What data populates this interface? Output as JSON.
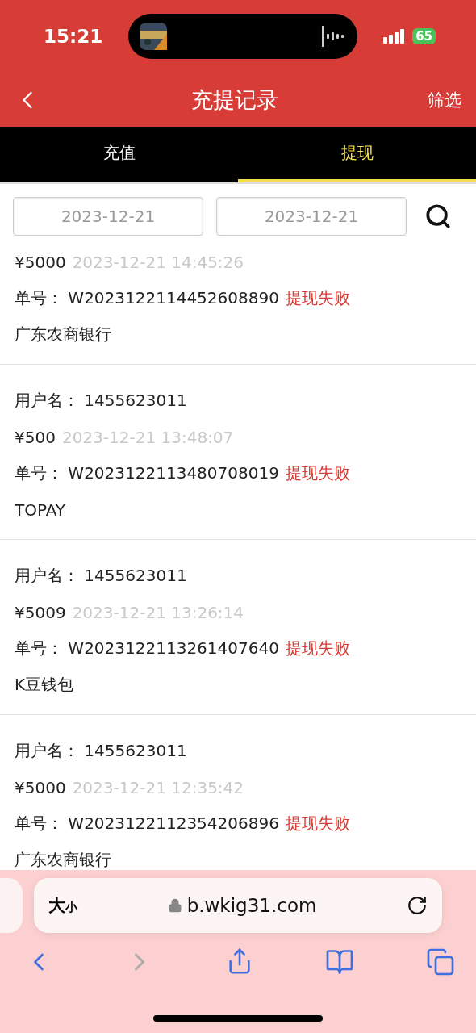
{
  "status_bar": {
    "time": "15:21",
    "battery": "65"
  },
  "header": {
    "title": "充提记录",
    "action": "筛选"
  },
  "tabs": [
    {
      "label": "充值",
      "selected": false
    },
    {
      "label": "提现",
      "selected": true
    }
  ],
  "filter": {
    "start_date": "2023-12-21",
    "end_date": "2023-12-21"
  },
  "records": [
    {
      "amount": "¥5000",
      "time": "2023-12-21 14:45:26",
      "order_label": "单号：",
      "order_no": "W2023122114452608890",
      "status": "提现失败",
      "method": "广东农商银行"
    },
    {
      "username_label": "用户名：",
      "username": "1455623011",
      "amount": "¥500",
      "time": "2023-12-21 13:48:07",
      "order_label": "单号：",
      "order_no": "W2023122113480708019",
      "status": "提现失败",
      "method": "TOPAY"
    },
    {
      "username_label": "用户名：",
      "username": "1455623011",
      "amount": "¥5009",
      "time": "2023-12-21 13:26:14",
      "order_label": "单号：",
      "order_no": "W2023122113261407640",
      "status": "提现失败",
      "method": "K豆钱包"
    },
    {
      "username_label": "用户名：",
      "username": "1455623011",
      "amount": "¥5000",
      "time": "2023-12-21 12:35:42",
      "order_label": "单号：",
      "order_no": "W2023122112354206896",
      "status": "提现失败",
      "method": "广东农商银行"
    }
  ],
  "browser": {
    "text_size_big": "大",
    "text_size_small": "小",
    "url": "b.wkig31.com",
    "forward_disabled": true
  }
}
